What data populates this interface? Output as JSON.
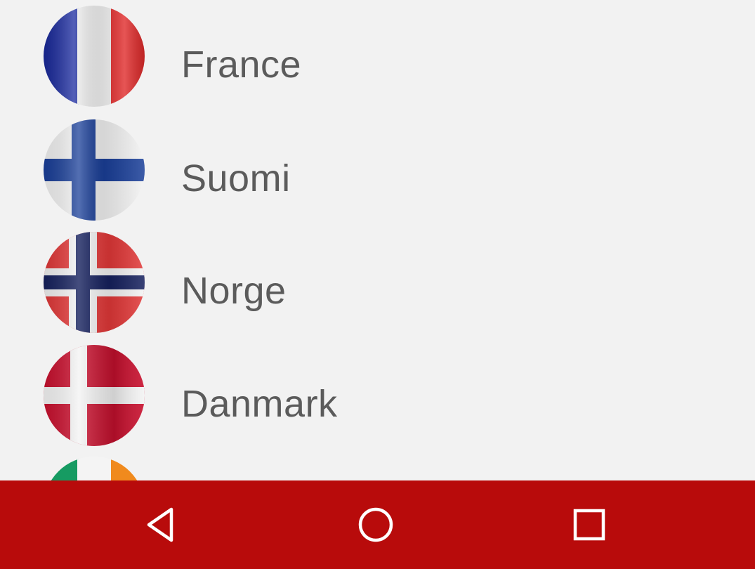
{
  "languages": [
    {
      "label": "France",
      "flag": "france-flag-icon"
    },
    {
      "label": "Suomi",
      "flag": "finland-flag-icon"
    },
    {
      "label": "Norge",
      "flag": "norway-flag-icon"
    },
    {
      "label": "Danmark",
      "flag": "denmark-flag-icon"
    },
    {
      "label": "",
      "flag": "ireland-flag-icon"
    }
  ],
  "navigation_bar": {
    "color": "#b80b0b",
    "buttons": [
      "back-icon",
      "home-icon",
      "recents-icon"
    ]
  },
  "colors": {
    "background": "#f2f2f2",
    "text": "#5b5b5b"
  }
}
